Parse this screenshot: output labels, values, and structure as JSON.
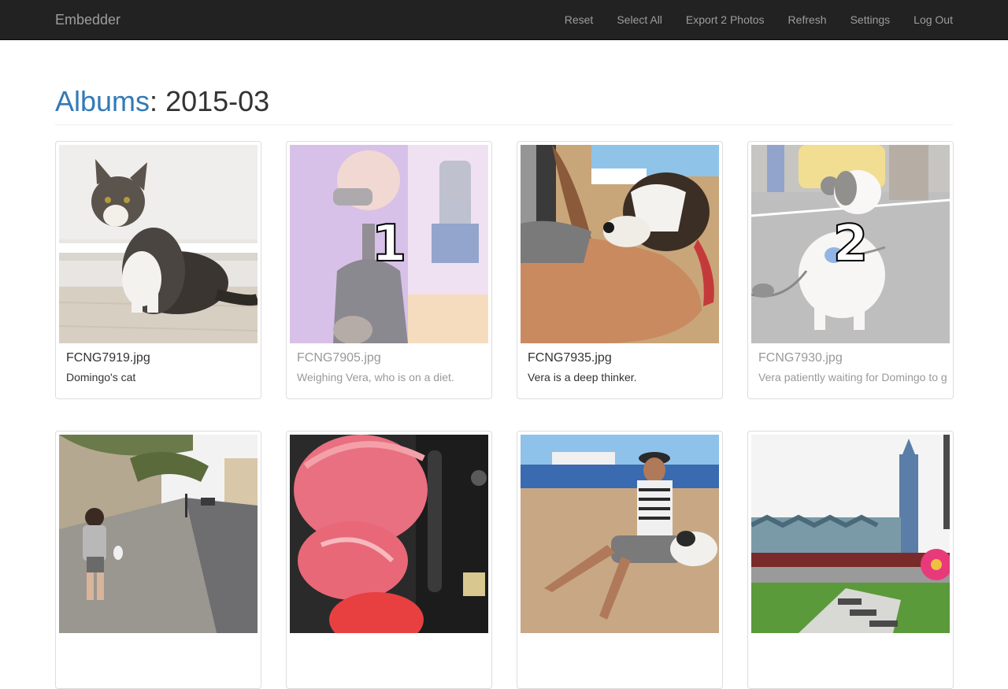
{
  "navbar": {
    "brand": "Embedder",
    "items": [
      {
        "label": "Reset"
      },
      {
        "label": "Select All"
      },
      {
        "label": "Export 2 Photos"
      },
      {
        "label": "Refresh"
      },
      {
        "label": "Settings"
      },
      {
        "label": "Log Out"
      }
    ]
  },
  "header": {
    "albums_link": "Albums",
    "separator": ": ",
    "album_name": "2015-03"
  },
  "photos": [
    {
      "filename": "FCNG7919.jpg",
      "caption": "Domingo's cat",
      "selected": false,
      "icon": "cat-photo"
    },
    {
      "filename": "FCNG7905.jpg",
      "caption": "Weighing Vera, who is on a diet.",
      "selected": true,
      "selection_number": "1",
      "icon": "weighing-dog-photo"
    },
    {
      "filename": "FCNG7935.jpg",
      "caption": "Vera is a deep thinker.",
      "selected": false,
      "icon": "dog-on-arm-photo"
    },
    {
      "filename": "FCNG7930.jpg",
      "caption": "Vera patiently waiting for Domingo to g",
      "selected": true,
      "selection_number": "2",
      "icon": "dog-on-street-photo"
    },
    {
      "filename": "",
      "caption": "",
      "selected": false,
      "icon": "street-walk-photo"
    },
    {
      "filename": "",
      "caption": "",
      "selected": false,
      "icon": "red-bags-photo"
    },
    {
      "filename": "",
      "caption": "",
      "selected": false,
      "icon": "beach-man-dog-photo"
    },
    {
      "filename": "",
      "caption": "",
      "selected": false,
      "icon": "london-skyline-photo"
    }
  ],
  "colors": {
    "navbar_bg": "#222222",
    "nav_text": "#9d9d9d",
    "link": "#337ab7"
  }
}
